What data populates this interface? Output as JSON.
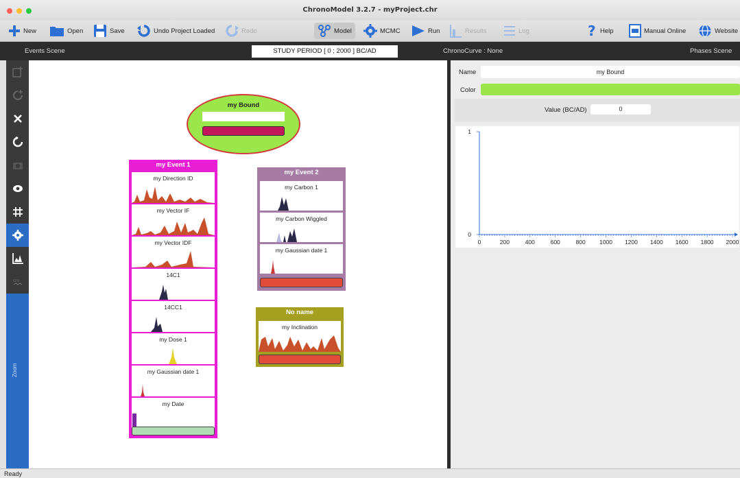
{
  "window": {
    "title": "ChronoModel 3.2.7 - myProject.chr"
  },
  "toolbar": {
    "new": "New",
    "open": "Open",
    "save": "Save",
    "undo": "Undo Project Loaded",
    "redo": "Redo",
    "model": "Model",
    "mcmc": "MCMC",
    "run": "Run",
    "results": "Results",
    "log": "Log",
    "help": "Help",
    "manual": "Manual Online",
    "website": "Website"
  },
  "scenebar": {
    "events_scene": "Events Scene",
    "study_period": "STUDY PERIOD [ 0 ; 2000 ] BC/AD",
    "chronocurve": "ChronoCurve : None",
    "phases_scene": "Phases Scene"
  },
  "sidebar": {
    "zoom_label": "Zoom"
  },
  "bound": {
    "title": "my Bound",
    "color": "#9be64a"
  },
  "events": [
    {
      "title": "my Event 1",
      "color": "#e91ed4",
      "dates": [
        {
          "label": "my Direction ID",
          "curve_color": "#c8502a"
        },
        {
          "label": "my Vector IF",
          "curve_color": "#c8502a"
        },
        {
          "label": "my Vector IDF",
          "curve_color": "#c8502a"
        },
        {
          "label": "14C1",
          "curve_color": "#2a2a48"
        },
        {
          "label": "14CC1",
          "curve_color": "#2a2a48"
        },
        {
          "label": "my Dose 1",
          "curve_color": "#e6d22a"
        },
        {
          "label": "my Gaussian date 1",
          "curve_color": "#c83a3a"
        },
        {
          "label": "my Date",
          "curve_color": "#7a2aa0"
        }
      ]
    },
    {
      "title": "my Event 2",
      "color": "#a67ba6",
      "dates": [
        {
          "label": "my Carbon 1",
          "curve_color": "#2a2a48"
        },
        {
          "label": "my Carbon Wiggled",
          "curve_color": "#2a2a48"
        },
        {
          "label": "my Gaussian date 1",
          "curve_color": "#c83a3a"
        }
      ]
    },
    {
      "title": "No name",
      "color": "#a6a020",
      "dates": [
        {
          "label": "my Inclination",
          "curve_color": "#c8502a"
        }
      ]
    }
  ],
  "properties": {
    "name_label": "Name",
    "name_value": "my Bound",
    "color_label": "Color",
    "color_value": "#9be64a",
    "value_label": "Value (BC/AD)",
    "value_value": "0"
  },
  "chart_data": {
    "type": "line",
    "x": [
      0,
      2000
    ],
    "series": [],
    "xlim": [
      0,
      2000
    ],
    "ylim": [
      0,
      1
    ],
    "xticks": [
      "0",
      "200",
      "400",
      "600",
      "800",
      "1000",
      "1200",
      "1400",
      "1600",
      "1800",
      "2000"
    ],
    "yticks": [
      "0",
      "1"
    ]
  },
  "status": {
    "text": "Ready"
  }
}
